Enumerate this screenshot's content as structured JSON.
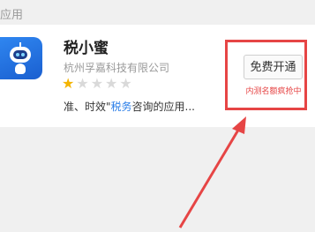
{
  "section": {
    "label": "应用"
  },
  "app": {
    "name": "税小蜜",
    "company": "杭州孚嘉科技有限公司",
    "rating": 1,
    "rating_max": 5,
    "description_prefix": "准、时效\"",
    "description_highlight": "税务",
    "description_suffix": "咨询的应用...",
    "icon": "robot-icon"
  },
  "action": {
    "button_label": "免费开通",
    "note": "内测名额疯抢中"
  },
  "colors": {
    "accent_red": "#e64545",
    "link_blue": "#2a7ee8",
    "star_gold": "#f4b400"
  }
}
